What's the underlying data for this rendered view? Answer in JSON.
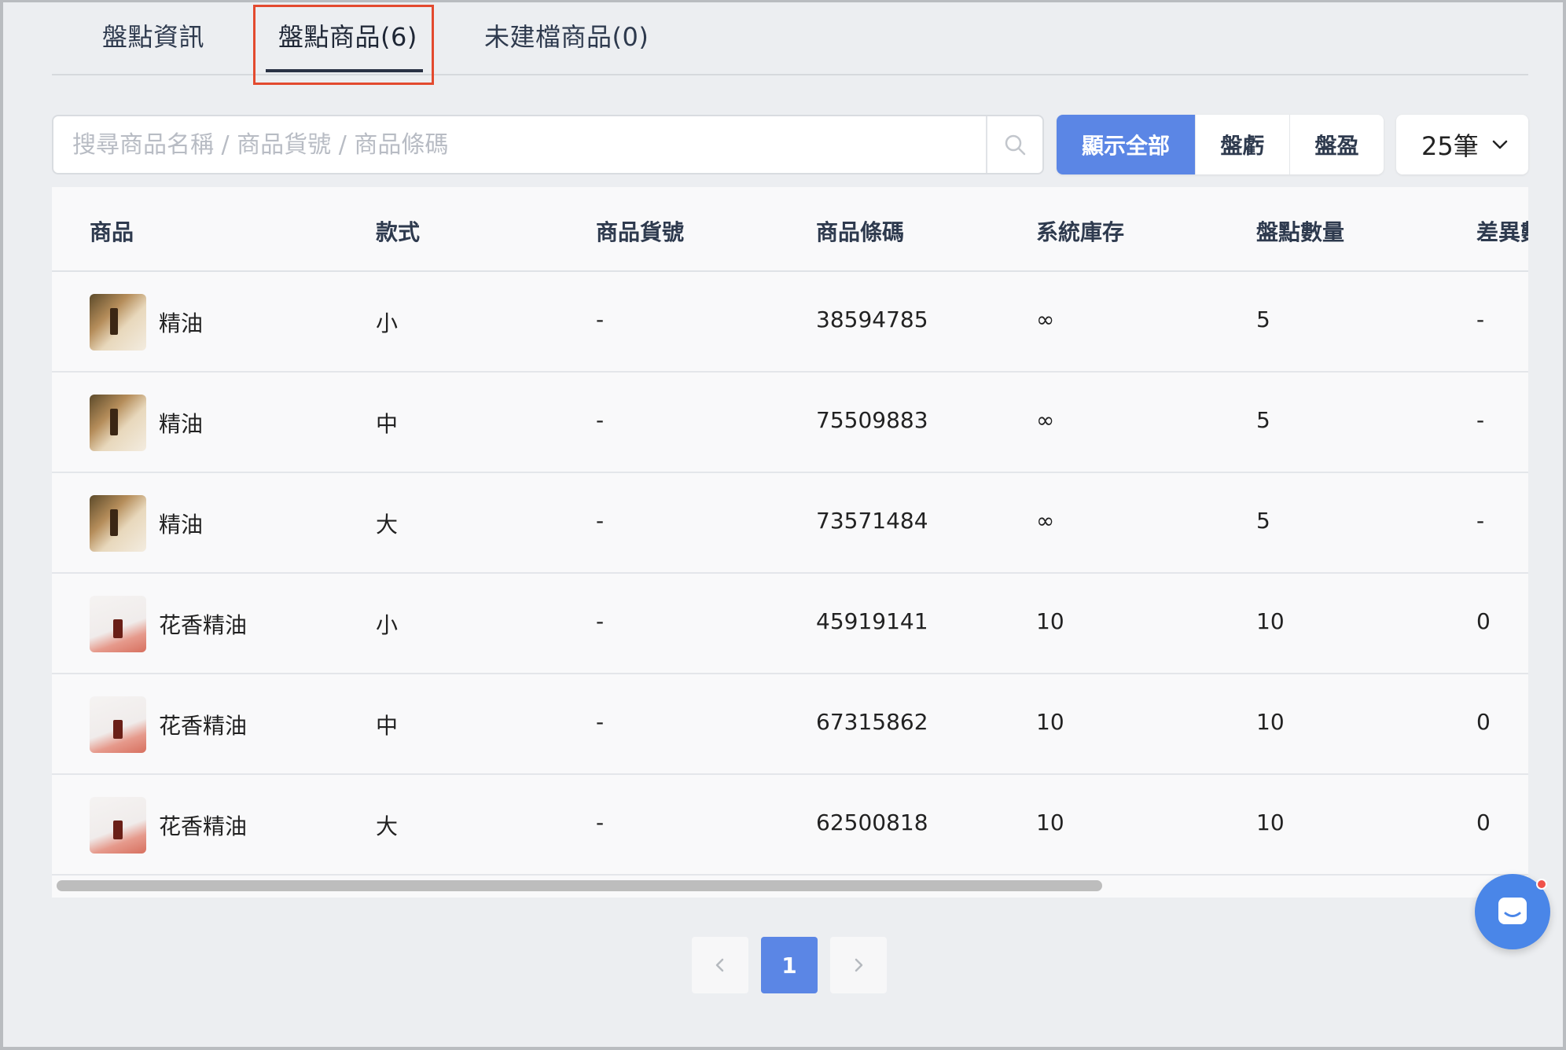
{
  "tabs": [
    {
      "label": "盤點資訊"
    },
    {
      "label": "盤點商品(6)"
    },
    {
      "label": "未建檔商品(0)"
    }
  ],
  "search": {
    "placeholder": "搜尋商品名稱 / 商品貨號 / 商品條碼"
  },
  "filters": [
    {
      "label": "顯示全部",
      "active": true
    },
    {
      "label": "盤虧"
    },
    {
      "label": "盤盈"
    }
  ],
  "page_size": {
    "selected": "25筆"
  },
  "table": {
    "columns": [
      "商品",
      "款式",
      "商品貨號",
      "商品條碼",
      "系統庫存",
      "盤點數量",
      "差異數"
    ],
    "rows": [
      {
        "name": "精油",
        "style": "小",
        "sku": "-",
        "barcode": "38594785",
        "stock": "∞",
        "counted": "5",
        "diff": "-"
      },
      {
        "name": "精油",
        "style": "中",
        "sku": "-",
        "barcode": "75509883",
        "stock": "∞",
        "counted": "5",
        "diff": "-"
      },
      {
        "name": "精油",
        "style": "大",
        "sku": "-",
        "barcode": "73571484",
        "stock": "∞",
        "counted": "5",
        "diff": "-"
      },
      {
        "name": "花香精油",
        "style": "小",
        "sku": "-",
        "barcode": "45919141",
        "stock": "10",
        "counted": "10",
        "diff": "0"
      },
      {
        "name": "花香精油",
        "style": "中",
        "sku": "-",
        "barcode": "67315862",
        "stock": "10",
        "counted": "10",
        "diff": "0"
      },
      {
        "name": "花香精油",
        "style": "大",
        "sku": "-",
        "barcode": "62500818",
        "stock": "10",
        "counted": "10",
        "diff": "0"
      }
    ]
  },
  "pagination": {
    "current": "1"
  },
  "colors": {
    "accent": "#5b86e5",
    "highlight": "#e34a2f",
    "chat": "#4a86e8",
    "notification": "#f0524a"
  },
  "icons": {
    "search": "search-icon",
    "dropdown": "chevron-down-icon",
    "prev": "chevron-left-icon",
    "next": "chevron-right-icon",
    "chat": "chat-icon"
  }
}
